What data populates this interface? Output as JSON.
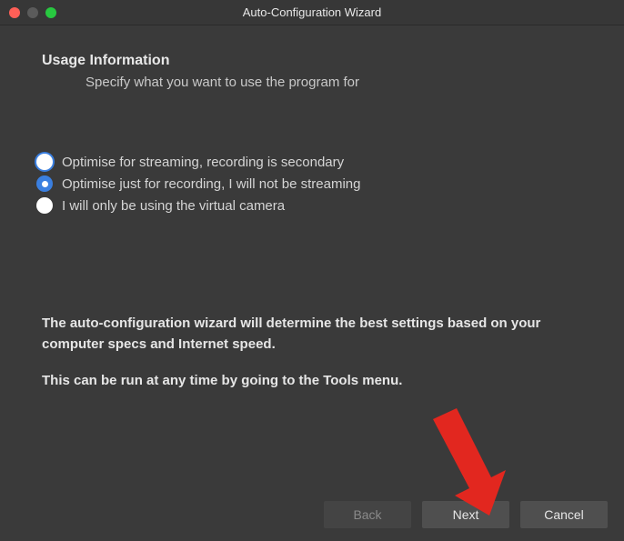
{
  "window": {
    "title": "Auto-Configuration Wizard"
  },
  "page": {
    "heading": "Usage Information",
    "subheading": "Specify what you want to use the program for"
  },
  "options": {
    "opt1": "Optimise for streaming, recording is secondary",
    "opt2": "Optimise just for recording, I will not be streaming",
    "opt3": "I will only be using the virtual camera",
    "selected": 1
  },
  "info": {
    "line1": "The auto-configuration wizard will determine the best settings based on your computer specs and Internet speed.",
    "line2": "This can be run at any time by going to the Tools menu."
  },
  "buttons": {
    "back": "Back",
    "next": "Next",
    "cancel": "Cancel"
  },
  "annotation": {
    "arrow_color": "#e2271f"
  }
}
